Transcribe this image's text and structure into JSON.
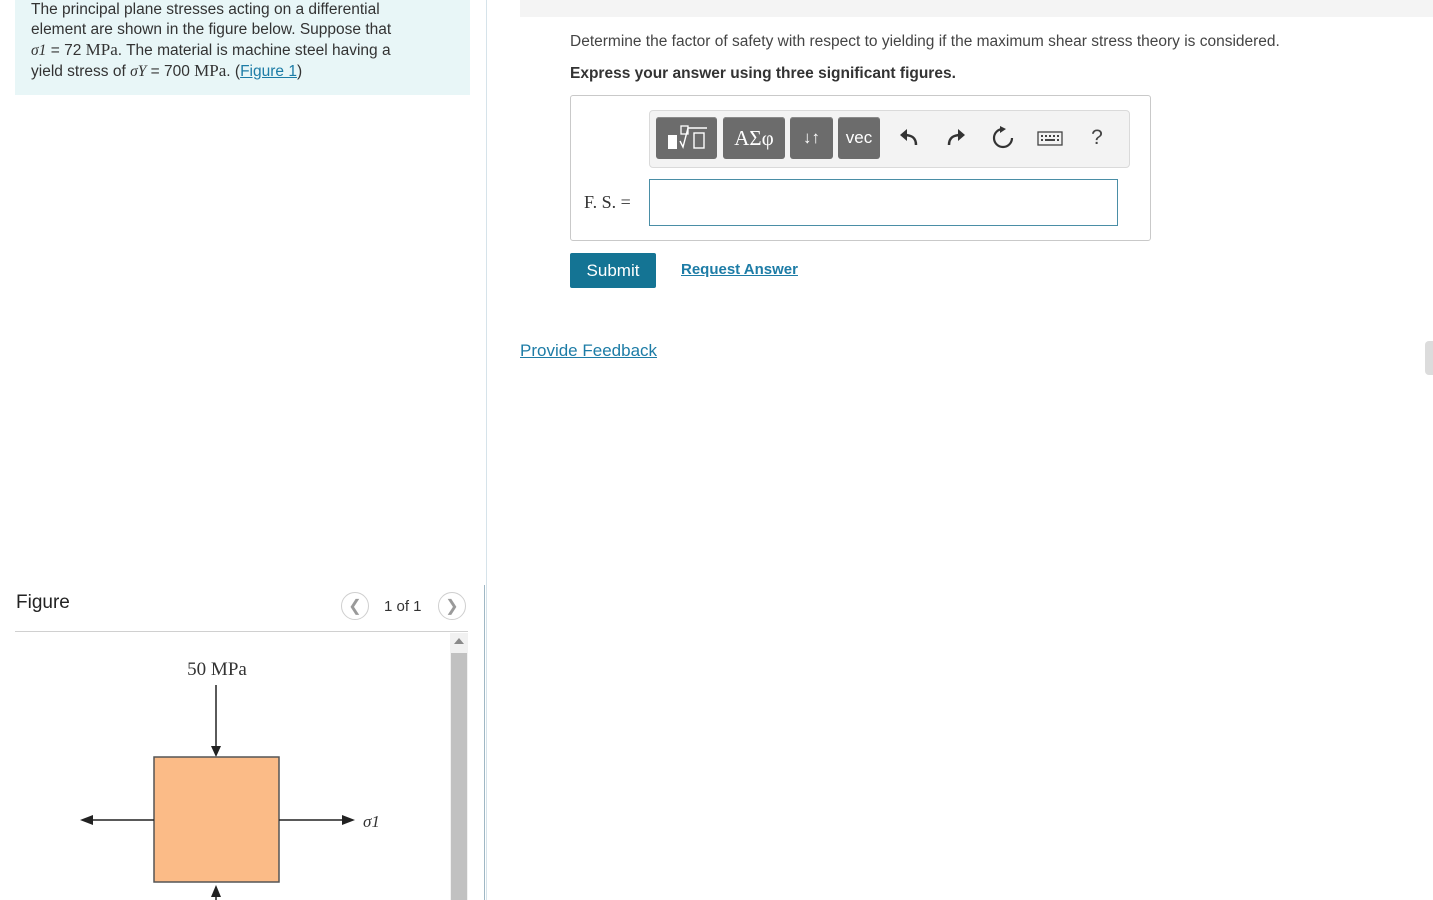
{
  "problem": {
    "line1": "The principal plane stresses acting on a differential",
    "line2": "element are shown in the figure below. Suppose that",
    "sigma1_symbol": "σ1",
    "sigma1_eq": " = 72 ",
    "sigma1_unit": "MPa",
    "line3_rest": ". The material is machine steel having a",
    "line4_start": "yield stress of ",
    "sigmaY_symbol": "σY",
    "sigmaY_eq": " = 700 ",
    "sigmaY_unit": "MPa",
    "line4_mid": ". (",
    "figure_link": "Figure 1",
    "line4_end": ")"
  },
  "figure": {
    "title": "Figure",
    "pager": "1 of 1",
    "prev_icon": "chevron-left-icon",
    "next_icon": "chevron-right-icon",
    "label_top": "50 MPa",
    "label_right": "σ1",
    "element_color": "#fbbb87"
  },
  "question": {
    "text": "Determine the factor of safety with respect to yielding if the maximum shear stress theory is considered.",
    "instruction": "Express your answer using three significant figures."
  },
  "toolbar": {
    "greek_label": "ΑΣφ",
    "arrows_label": "↓↑",
    "vec_label": "vec",
    "help_label": "?",
    "icons": [
      "templates-icon",
      "greek-icon",
      "arrows-icon",
      "vec-icon",
      "undo-icon",
      "redo-icon",
      "reset-icon",
      "keyboard-icon",
      "help-icon"
    ]
  },
  "answer": {
    "label": "F. S. =",
    "value": ""
  },
  "actions": {
    "submit": "Submit",
    "request": "Request Answer",
    "feedback": "Provide Feedback"
  },
  "colors": {
    "accent": "#147494",
    "link": "#1d7ca6",
    "problem_bg": "#e8f6f7"
  }
}
